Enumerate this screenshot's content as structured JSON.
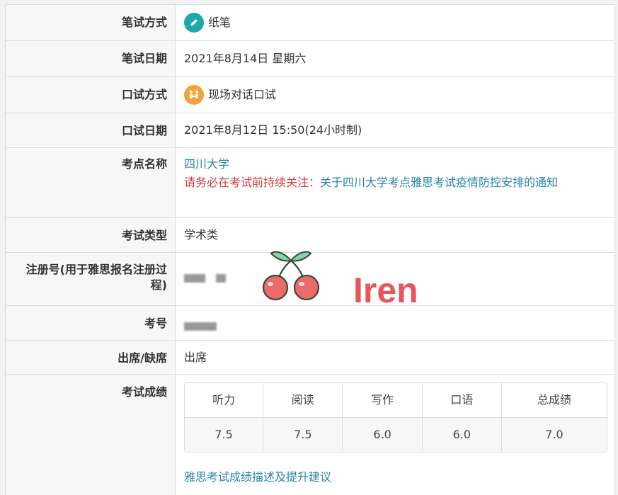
{
  "rows": {
    "written_method": {
      "label": "笔试方式",
      "value": "纸笔",
      "icon": "pencil-icon",
      "icon_color": "#1fa7ad"
    },
    "written_date": {
      "label": "笔试日期",
      "value": "2021年8月14日 星期六"
    },
    "speaking_method": {
      "label": "口试方式",
      "value": "现场对话口试",
      "icon": "face-to-face-icon",
      "icon_color": "#f3a33a"
    },
    "speaking_date": {
      "label": "口试日期",
      "value": "2021年8月12日 15:50(24小时制)"
    },
    "test_center": {
      "label": "考点名称",
      "value": "四川大学",
      "notice_prefix": "请务必在考试前持续关注：",
      "notice_link": "关于四川大学考点雅思考试疫情防控安排的通知"
    },
    "test_type": {
      "label": "考试类型",
      "value": "学术类"
    },
    "registration_no": {
      "label": "注册号(用于雅思报名注册过程)"
    },
    "candidate_no": {
      "label": "考号"
    },
    "attendance": {
      "label": "出席/缺席",
      "value": "出席"
    },
    "results": {
      "label": "考试成绩",
      "headers": [
        "听力",
        "阅读",
        "写作",
        "口语",
        "总成绩"
      ],
      "scores": [
        "7.5",
        "7.5",
        "6.0",
        "6.0",
        "7.0"
      ],
      "link": "雅思考试成绩描述及提升建议"
    }
  },
  "watermark": {
    "text": "Iren",
    "sticker": "cherry-icon",
    "color": "#e8555c"
  }
}
